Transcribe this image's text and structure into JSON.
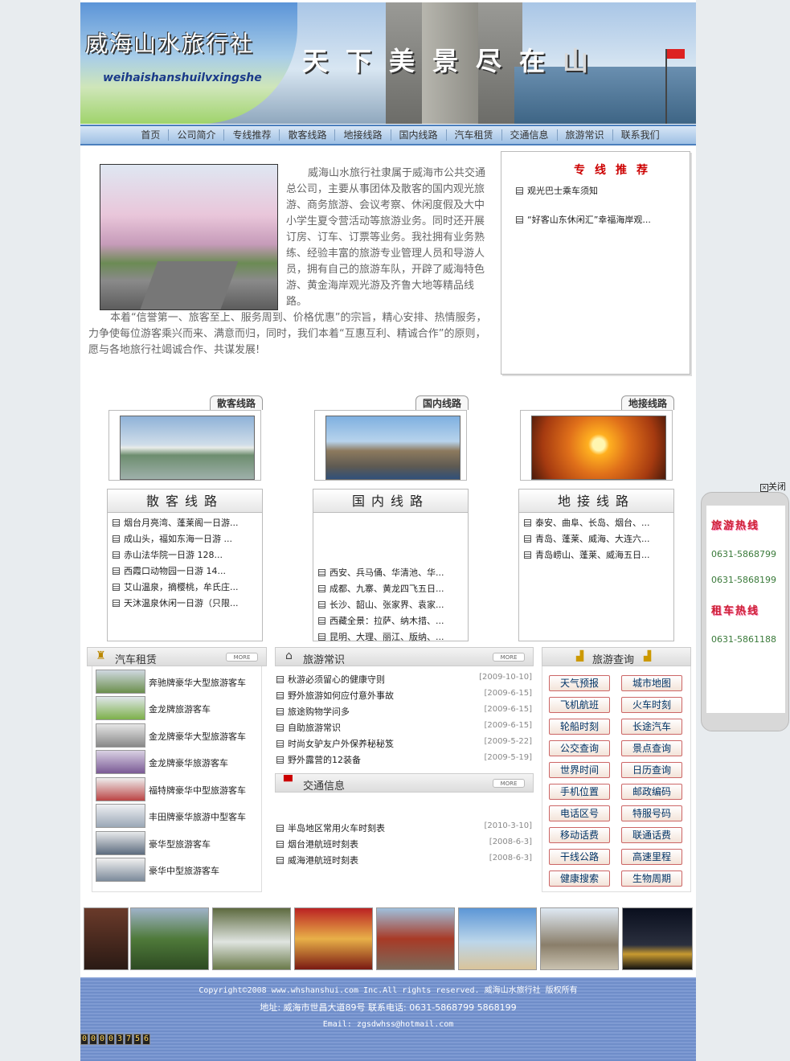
{
  "header": {
    "logo_cn": "威海山水旅行社",
    "logo_en": "weihaishanshuilvxingshe",
    "slogan_main": "天下美景尽在",
    "slogan_dim": "山"
  },
  "nav": [
    "首页",
    "公司简介",
    "专线推荐",
    "散客线路",
    "地接线路",
    "国内线路",
    "汽车租赁",
    "交通信息",
    "旅游常识",
    "联系我们"
  ],
  "intro": {
    "p1": "威海山水旅行社隶属于威海市公共交通总公司，主要从事团体及散客的国内观光旅游、商务旅游、会议考察、休闲度假及大中小学生夏令营活动等旅游业务。同时还开展订房、订车、订票等业务。我社拥有业务熟练、经验丰富的旅游专业管理人员和导游人员，拥有自己的旅游车队，开辟了威海特色游、黄金海岸观光游及齐鲁大地等精品线路。",
    "p2": "本着“信誉第一、旅客至上、服务周到、价格优惠”的宗旨，精心安排、热情服务，力争使每位游客乘兴而来、满意而归，同时，我们本着“互惠互利、精诚合作”的原则，愿与各地旅行社竭诚合作、共谋发展!"
  },
  "special": {
    "title": "专线推荐",
    "items": [
      "观光巴士乘车须知",
      "“好客山东休闲汇”幸福海岸观..."
    ]
  },
  "routes": [
    {
      "tab": "散客线路",
      "head": "散客线路",
      "items": [
        "烟台月亮湾、蓬莱阁一日游...",
        "成山头，福如东海一日游  ...",
        "赤山法华院一日游  128...",
        "西霞口动物园一日游  14...",
        "艾山温泉，摘樱桃，牟氏庄...",
        "天沐温泉休闲一日游（只限..."
      ]
    },
    {
      "tab": "国内线路",
      "head": "国内线路",
      "items": [
        "西安、兵马俑、华清池、华...",
        "成都、九寨、黄龙四飞五日...",
        "长沙、韶山、张家界、袁家...",
        "西藏全景：拉萨、纳木措、...",
        "昆明、大理、丽江、版纳、..."
      ]
    },
    {
      "tab": "地接线路",
      "head": "地接线路",
      "items": [
        "泰安、曲阜、长岛、烟台、...",
        "青岛、蓬莱、威海、大连六...",
        "青岛崂山、蓬莱、威海五日..."
      ]
    }
  ],
  "car_rental": {
    "title": "汽车租赁",
    "more": "MORE",
    "items": [
      "奔驰牌豪华大型旅游客车",
      "金龙牌旅游客车",
      "金龙牌豪华大型旅游客车",
      "金龙牌豪华旅游客车",
      "福特牌豪华中型旅游客车",
      "丰田牌豪华旅游中型客车",
      "豪华型旅游客车",
      "豪华中型旅游客车"
    ]
  },
  "tips": {
    "title": "旅游常识",
    "more": "MORE",
    "items": [
      {
        "title": "秋游必须留心的健康守则",
        "date": "[2009-10-10]"
      },
      {
        "title": "野外旅游如何应付意外事故",
        "date": "[2009-6-15]"
      },
      {
        "title": "旅途购物学问多",
        "date": "[2009-6-15]"
      },
      {
        "title": "自助旅游常识",
        "date": "[2009-6-15]"
      },
      {
        "title": "时尚女驴友户外保养秘秘笈",
        "date": "[2009-5-22]"
      },
      {
        "title": "野外露营的12装备",
        "date": "[2009-5-19]"
      }
    ]
  },
  "traffic": {
    "title": "交通信息",
    "more": "MORE",
    "items": [
      {
        "title": "半岛地区常用火车时刻表",
        "date": "[2010-3-10]"
      },
      {
        "title": "烟台港航班时刻表",
        "date": "[2008-6-3]"
      },
      {
        "title": "威海港航班时刻表",
        "date": "[2008-6-3]"
      }
    ]
  },
  "query": {
    "title": "旅游查询",
    "buttons": [
      "天气预报",
      "城市地图",
      "飞机航班",
      "火车时刻",
      "轮船时刻",
      "长途汽车",
      "公交查询",
      "景点查询",
      "世界时间",
      "日历查询",
      "手机位置",
      "邮政编码",
      "电话区号",
      "特服号码",
      "移动话费",
      "联通话费",
      "干线公路",
      "高速里程",
      "健康搜索",
      "生物周期"
    ]
  },
  "footer": {
    "copyright": "Copyright©2008 www.whshanshui.com Inc.All rights reserved. 威海山水旅行社 版权所有",
    "address": "地址: 威海市世昌大道89号 联系电话: 0631-5868799 5868199",
    "email": "Email: zgsdwhss@hotmail.com",
    "counter": "00003756"
  },
  "hotline": {
    "close": "关闭",
    "travel_title": "旅游热线",
    "travel_numbers": [
      "0631-5868799",
      "0631-5868199"
    ],
    "rent_title": "租车热线",
    "rent_number": "0631-5861188"
  },
  "colors": {
    "nav_border": "#4b7fbd",
    "accent_red": "#cc0000",
    "footer_bg": "#7f9bd3"
  }
}
